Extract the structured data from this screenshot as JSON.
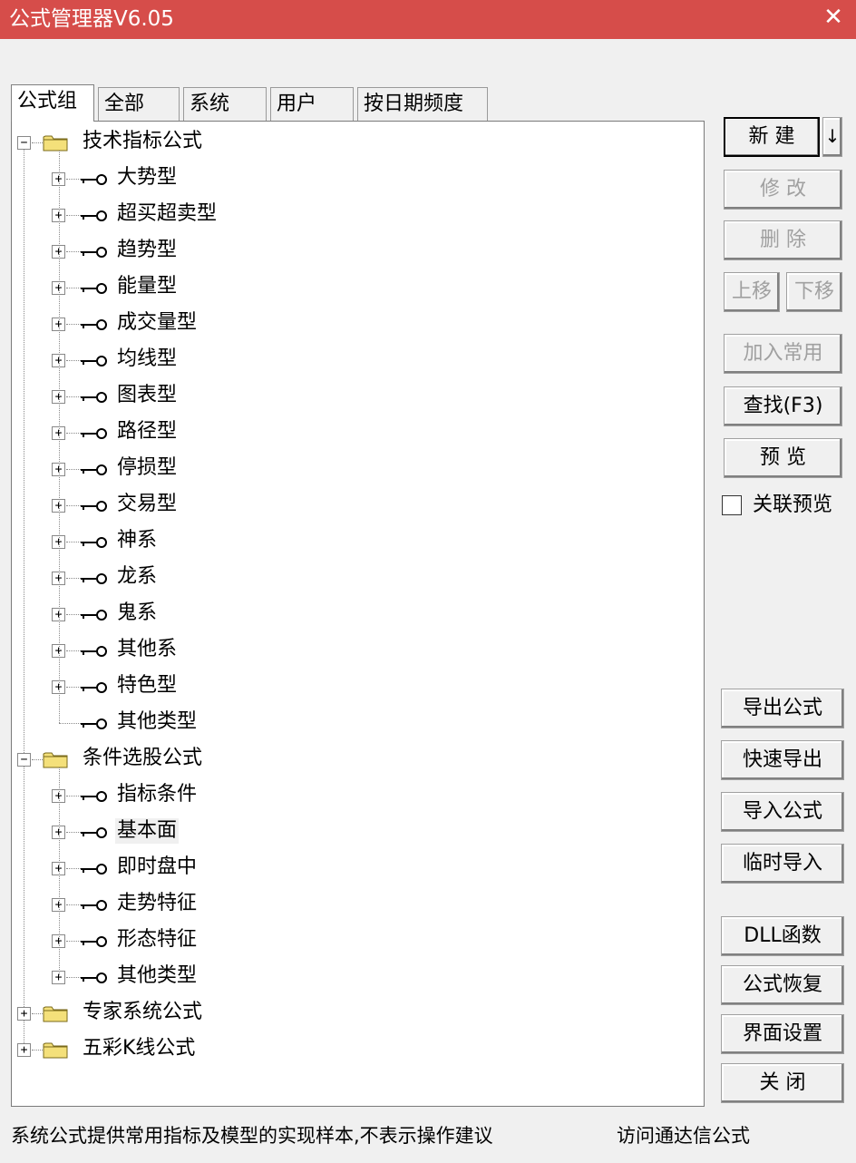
{
  "window": {
    "title": "公式管理器V6.05",
    "close_glyph": "✕"
  },
  "tabs": [
    {
      "label": "公式组",
      "active": true
    },
    {
      "label": "全部",
      "active": false
    },
    {
      "label": "系统",
      "active": false
    },
    {
      "label": "用户",
      "active": false
    },
    {
      "label": "按日期频度",
      "active": false
    }
  ],
  "tree": {
    "groups": [
      {
        "label": "技术指标公式",
        "expanded": true,
        "icon": "folder-icon",
        "children": [
          {
            "label": "大势型",
            "expandable": true
          },
          {
            "label": "超买超卖型",
            "expandable": true
          },
          {
            "label": "趋势型",
            "expandable": true
          },
          {
            "label": "能量型",
            "expandable": true
          },
          {
            "label": "成交量型",
            "expandable": true
          },
          {
            "label": "均线型",
            "expandable": true
          },
          {
            "label": "图表型",
            "expandable": true
          },
          {
            "label": "路径型",
            "expandable": true
          },
          {
            "label": "停损型",
            "expandable": true
          },
          {
            "label": "交易型",
            "expandable": true
          },
          {
            "label": "神系",
            "expandable": true
          },
          {
            "label": "龙系",
            "expandable": true
          },
          {
            "label": "鬼系",
            "expandable": true
          },
          {
            "label": "其他系",
            "expandable": true
          },
          {
            "label": "特色型",
            "expandable": true
          },
          {
            "label": "其他类型",
            "expandable": false
          }
        ]
      },
      {
        "label": "条件选股公式",
        "expanded": true,
        "icon": "folder-icon",
        "children": [
          {
            "label": "指标条件",
            "expandable": true
          },
          {
            "label": "基本面",
            "expandable": true,
            "selected": true
          },
          {
            "label": "即时盘中",
            "expandable": true
          },
          {
            "label": "走势特征",
            "expandable": true
          },
          {
            "label": "形态特征",
            "expandable": true
          },
          {
            "label": "其他类型",
            "expandable": true
          }
        ]
      },
      {
        "label": "专家系统公式",
        "expanded": false,
        "icon": "folder-icon",
        "children": []
      },
      {
        "label": "五彩K线公式",
        "expanded": false,
        "icon": "folder-icon",
        "children": []
      }
    ]
  },
  "buttons": {
    "new": "新 建",
    "new_arrow": "↓",
    "modify": "修 改",
    "delete": "删 除",
    "move_up": "上移",
    "move_down": "下移",
    "add_common": "加入常用",
    "find": "查找(F3)",
    "preview": "预 览",
    "export": "导出公式",
    "quick_export": "快速导出",
    "import": "导入公式",
    "temp_import": "临时导入",
    "dll": "DLL函数",
    "restore": "公式恢复",
    "ui_settings": "界面设置",
    "close": "关 闭"
  },
  "linked_preview": {
    "label": "关联预览",
    "checked": false
  },
  "status": {
    "left": "系统公式提供常用指标及模型的实现样本,不表示操作建议",
    "right": "访问通达信公式"
  },
  "colors": {
    "titlebar": "#d64d4a",
    "folder": "#f4e07a"
  }
}
